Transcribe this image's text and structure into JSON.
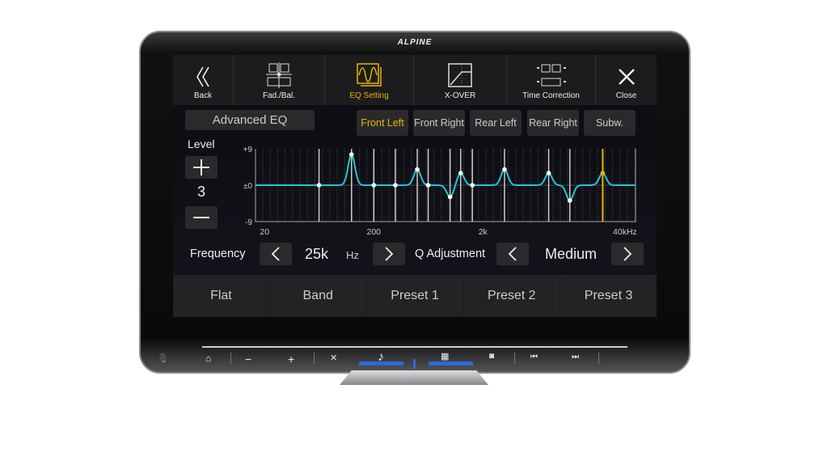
{
  "brand": "ALPINE",
  "topbar": {
    "items": [
      {
        "label": "Back",
        "icon": "double-chevron-left-icon"
      },
      {
        "label": "Fad./Bal.",
        "icon": "fader-balance-icon"
      },
      {
        "label": "EQ Setting",
        "icon": "eq-wave-icon",
        "active": true
      },
      {
        "label": "X-OVER",
        "icon": "crossover-icon"
      },
      {
        "label": "Time Correction",
        "icon": "time-correction-icon"
      },
      {
        "label": "Close",
        "icon": "close-icon"
      }
    ]
  },
  "advanced_eq": "Advanced EQ",
  "channels": [
    {
      "label": "Front Left",
      "active": true
    },
    {
      "label": "Front Right"
    },
    {
      "label": "Rear Left"
    },
    {
      "label": "Rear Right"
    },
    {
      "label": "Subw."
    }
  ],
  "level": {
    "label": "Level",
    "value": "3"
  },
  "accent": "#e8b400",
  "curve_color": "#1ec8dc",
  "chart_data": {
    "type": "line",
    "yticks": [
      "+9",
      "±0",
      "-9"
    ],
    "xticks": [
      "20",
      "200",
      "2k",
      "40kHz"
    ],
    "ylim": [
      -9,
      9
    ],
    "xlim_hz": [
      16.5,
      50000
    ],
    "x_scale": "log",
    "bands_hz": [
      63,
      125,
      200,
      315,
      500,
      630,
      1000,
      1250,
      1600,
      3150,
      8000,
      12500,
      25000
    ],
    "gains_db": [
      0,
      7.6,
      0,
      0,
      3.9,
      0,
      -2.9,
      3,
      0,
      3.9,
      3,
      -3.8,
      3
    ],
    "selected_band": 12
  },
  "frequency": {
    "label": "Frequency",
    "value": "25k",
    "unit": "Hz"
  },
  "q": {
    "label": "Q Adjustment",
    "value": "Medium"
  },
  "presets": [
    "Flat",
    "Band",
    "Preset 1",
    "Preset 2",
    "Preset 3"
  ],
  "hw": {
    "minus": "−",
    "plus": "+"
  }
}
